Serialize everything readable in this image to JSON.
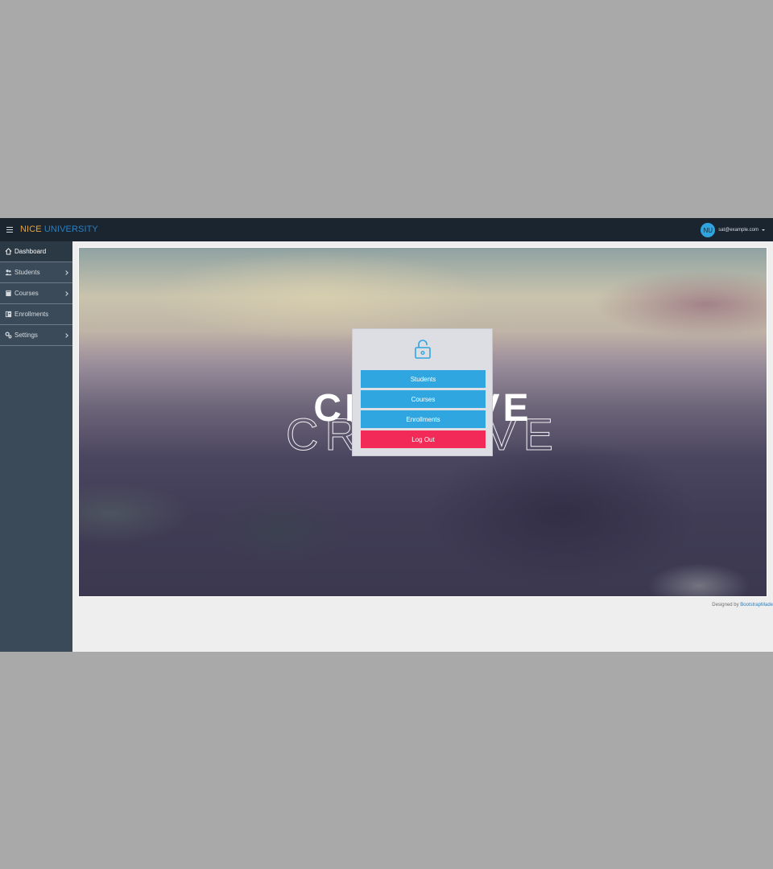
{
  "navbar": {
    "brand_part1": "NICE",
    "brand_part2": "UNIVERSITY",
    "avatar_initials": "NU",
    "user_email": "sat@example.com",
    "menu_icon": "hamburger-icon"
  },
  "sidebar": {
    "items": [
      {
        "label": "Dashboard",
        "icon": "home-icon",
        "active": true,
        "has_children": false
      },
      {
        "label": "Students",
        "icon": "users-icon",
        "active": false,
        "has_children": true
      },
      {
        "label": "Courses",
        "icon": "book-icon",
        "active": false,
        "has_children": true
      },
      {
        "label": "Enrollments",
        "icon": "id-card-icon",
        "active": false,
        "has_children": false
      },
      {
        "label": "Settings",
        "icon": "gears-icon",
        "active": false,
        "has_children": true
      }
    ]
  },
  "hero": {
    "text": "CREATIVE"
  },
  "menu": {
    "icon": "unlock-icon",
    "buttons": {
      "students": "Students",
      "courses": "Courses",
      "enrollments": "Enrollments",
      "logout": "Log Out"
    }
  },
  "footer": {
    "prefix": "Designed by",
    "link": "BootstrapMade"
  },
  "colors": {
    "navbar_bg": "#1b2530",
    "sidebar_bg": "#3a4a58",
    "brand_orange": "#e8a23c",
    "brand_blue": "#2a7fc0",
    "button_blue": "#2fa6df",
    "button_red": "#f12a58"
  }
}
